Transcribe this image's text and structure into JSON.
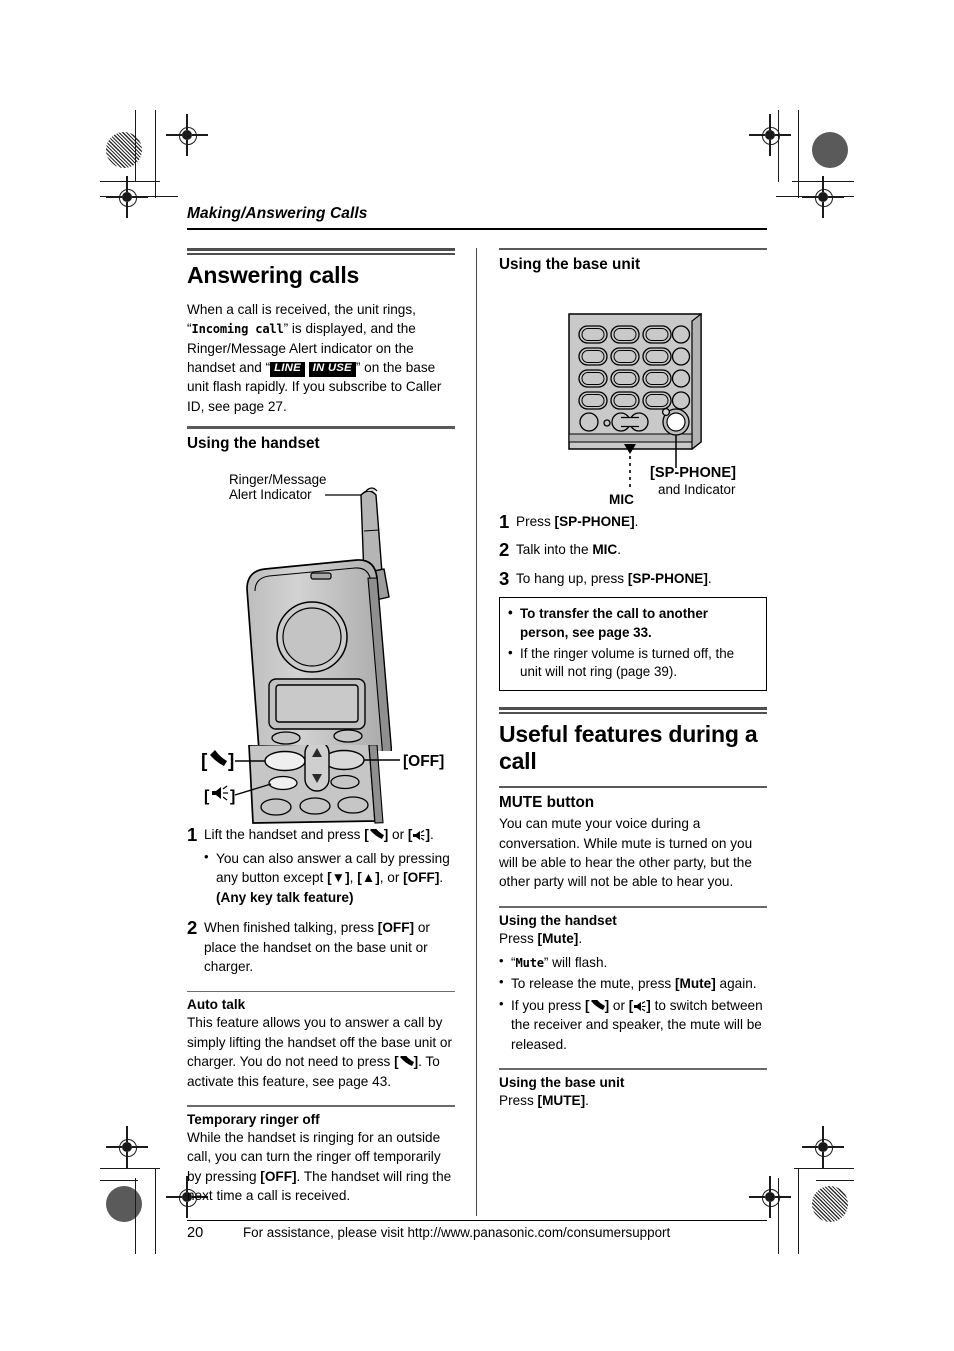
{
  "running_head": "Making/Answering Calls",
  "left_column": {
    "section_title": "Answering calls",
    "intro": {
      "part1": "When a call is received, the unit rings, “",
      "display_text": "Incoming call",
      "part2": "” is displayed, and the Ringer/Message Alert indicator on the handset and “",
      "badge1": "LINE",
      "badge2": "IN USE",
      "part3": "” on the base unit flash rapidly. If you subscribe to Caller ID, see page 27."
    },
    "subhead_handset": "Using the handset",
    "figure": {
      "callout_indicator_line1": "Ringer/Message",
      "callout_indicator_line2": "Alert Indicator",
      "callout_talk": "talk-key",
      "callout_speaker": "speaker-key",
      "callout_off": "OFF"
    },
    "steps": [
      {
        "num": "1",
        "text_before": "Lift the handset and press ",
        "text_mid": " or ",
        "text_after": ".",
        "bullets": [
          {
            "p1": "You can also answer a call by pressing any button except ",
            "k1": "▼",
            "p2": ", ",
            "k2": "▲",
            "p3": ", or ",
            "k3": "OFF",
            "p4": ". ",
            "bold_tail": "(Any key talk feature)"
          }
        ]
      },
      {
        "num": "2",
        "text_before": "When finished talking, press ",
        "key": "OFF",
        "text_after": " or place the handset on the base unit or charger."
      }
    ],
    "auto_talk": {
      "heading": "Auto talk",
      "p1": "This feature allows you to answer a call by simply lifting the handset off the base unit or charger. You do not need to press ",
      "p2": ". To activate this feature, see page 43."
    },
    "temp_ringer": {
      "heading": "Temporary ringer off",
      "p1": "While the handset is ringing for an outside call, you can turn the ringer off temporarily by pressing ",
      "key": "OFF",
      "p2": ". The handset will ring the next time a call is received."
    }
  },
  "right_column": {
    "subhead_base": "Using the base unit",
    "figure": {
      "callout_spphone": "SP-PHONE",
      "callout_and_indicator": "and Indicator",
      "callout_mic": "MIC"
    },
    "steps": [
      {
        "num": "1",
        "before": "Press ",
        "key": "SP-PHONE",
        "after": "."
      },
      {
        "num": "2",
        "before": "Talk into the ",
        "key": "MIC",
        "after": "."
      },
      {
        "num": "3",
        "before": "To hang up, press ",
        "key": "SP-PHONE",
        "after": "."
      }
    ],
    "notebox": [
      "To transfer the call to another person, see page 33.",
      "If the ringer volume is turned off, the unit will not ring (page 39)."
    ],
    "section_title": "Useful features during a call",
    "mute": {
      "heading": "MUTE button",
      "body": "You can mute your voice during a conversation. While mute is turned on you will be able to hear the other party, but the other party will not be able to hear you.",
      "handset_heading": "Using the handset",
      "handset_press_before": "Press ",
      "handset_press_key": "Mute",
      "handset_press_after": ".",
      "bullets": {
        "b1_q": "Mute",
        "b1_tail": " will flash.",
        "b2_before": "To release the mute, press ",
        "b2_key": "Mute",
        "b2_after": " again.",
        "b3_before": "If you press ",
        "b3_mid": " or ",
        "b3_after": " to switch between the receiver and speaker, the mute will be released."
      },
      "base_heading": "Using the base unit",
      "base_press_before": "Press ",
      "base_press_key": "MUTE",
      "base_press_after": "."
    }
  },
  "footer": {
    "page_number": "20",
    "text": "For assistance, please visit http://www.panasonic.com/consumersupport"
  },
  "colors": {
    "ink": "#000000",
    "rule_gray": "#4f4f4f",
    "device_fill": "#c9c9c9",
    "device_dark": "#9a9a9a"
  }
}
